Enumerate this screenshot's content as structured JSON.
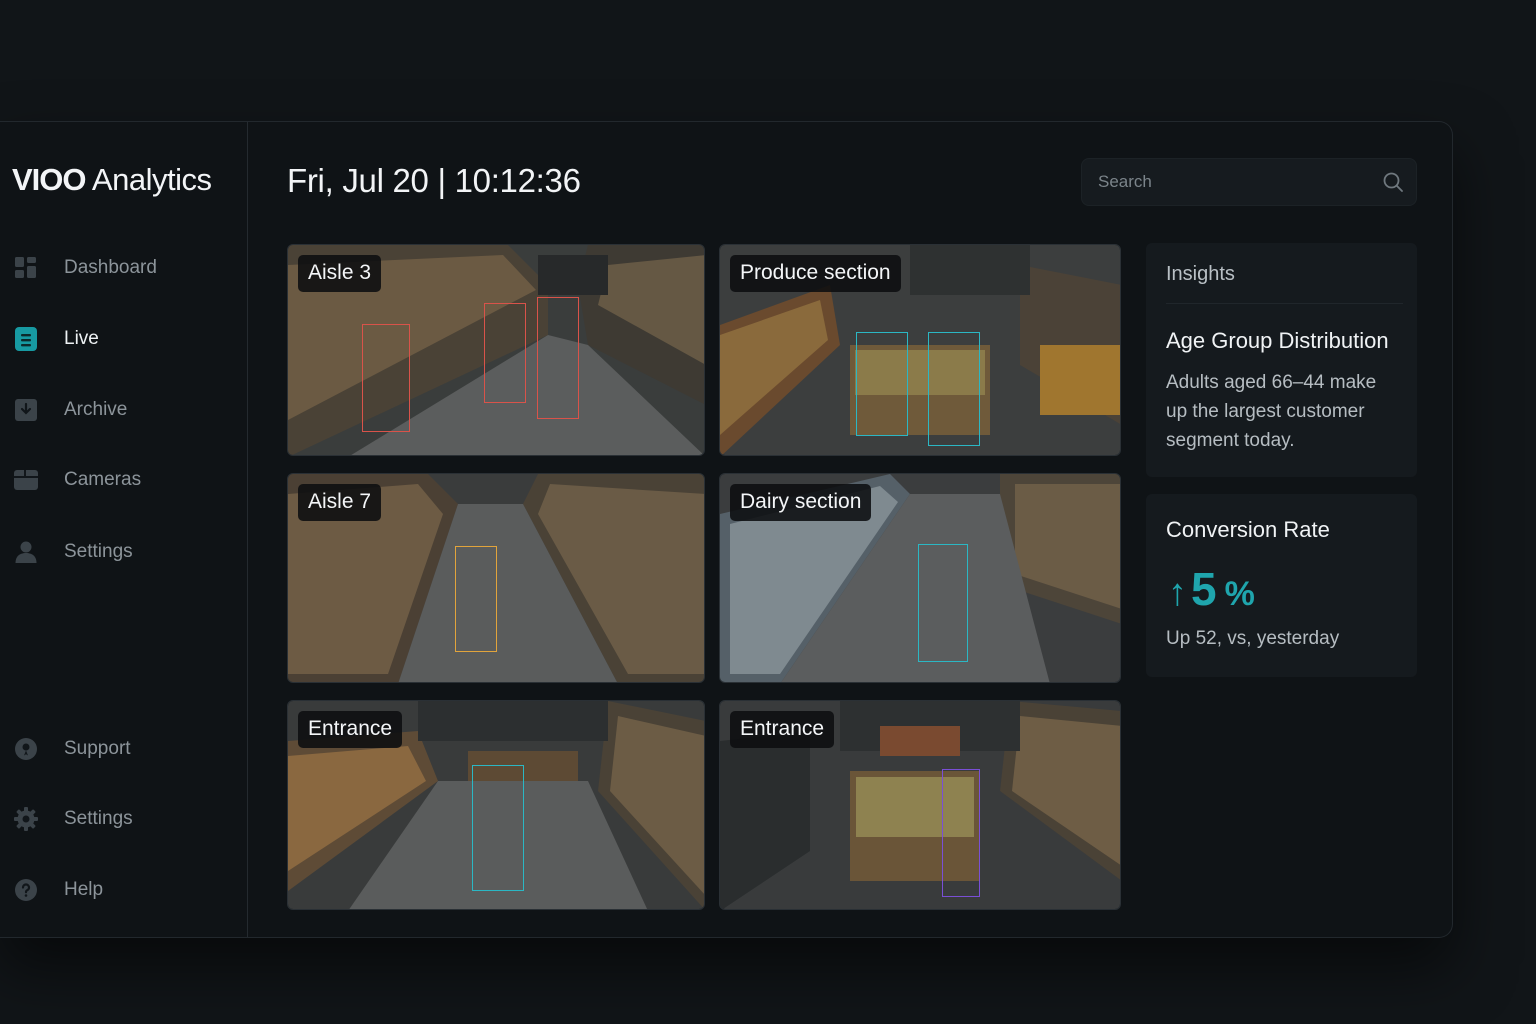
{
  "app": {
    "brand_bold": "VIOO",
    "brand_rest": "Analytics"
  },
  "nav": {
    "primary": [
      {
        "label": "Dashboard",
        "icon": "grid-icon",
        "active": false
      },
      {
        "label": "Live",
        "icon": "live-icon",
        "active": true
      },
      {
        "label": "Archive",
        "icon": "archive-icon",
        "active": false
      },
      {
        "label": "Cameras",
        "icon": "camera-icon",
        "active": false
      },
      {
        "label": "Settings",
        "icon": "user-icon",
        "active": false
      }
    ],
    "secondary": [
      {
        "label": "Support",
        "icon": "support-icon"
      },
      {
        "label": "Settings",
        "icon": "gear-icon"
      },
      {
        "label": "Help",
        "icon": "help-icon"
      }
    ]
  },
  "header": {
    "datetime": "Fri, Jul 20 | 10:12:36"
  },
  "search": {
    "placeholder": "Search"
  },
  "feeds": [
    {
      "label": "Aisle 3",
      "box_color": "#d9534a"
    },
    {
      "label": "Produce section",
      "box_color": "#2bb7c4"
    },
    {
      "label": "Aisle 7",
      "box_color": "#e1a43c"
    },
    {
      "label": "Dairy section",
      "box_color": "#2bb7c4"
    },
    {
      "label": "Entrance",
      "box_color": "#2bb7c4"
    },
    {
      "label": "Entrance",
      "box_color": "#7a4fd6"
    }
  ],
  "insights": {
    "heading": "Insights",
    "age": {
      "title": "Age Group Distribution",
      "body": "Adults aged 66–44 make up the largest customer segment today."
    }
  },
  "conversion": {
    "title": "Conversion Rate",
    "arrow": "↑",
    "value": "5",
    "unit": "%",
    "sub": "Up 52, vs, yesterday"
  },
  "colors": {
    "accent": "#1fa5ad",
    "background": "#111518"
  }
}
